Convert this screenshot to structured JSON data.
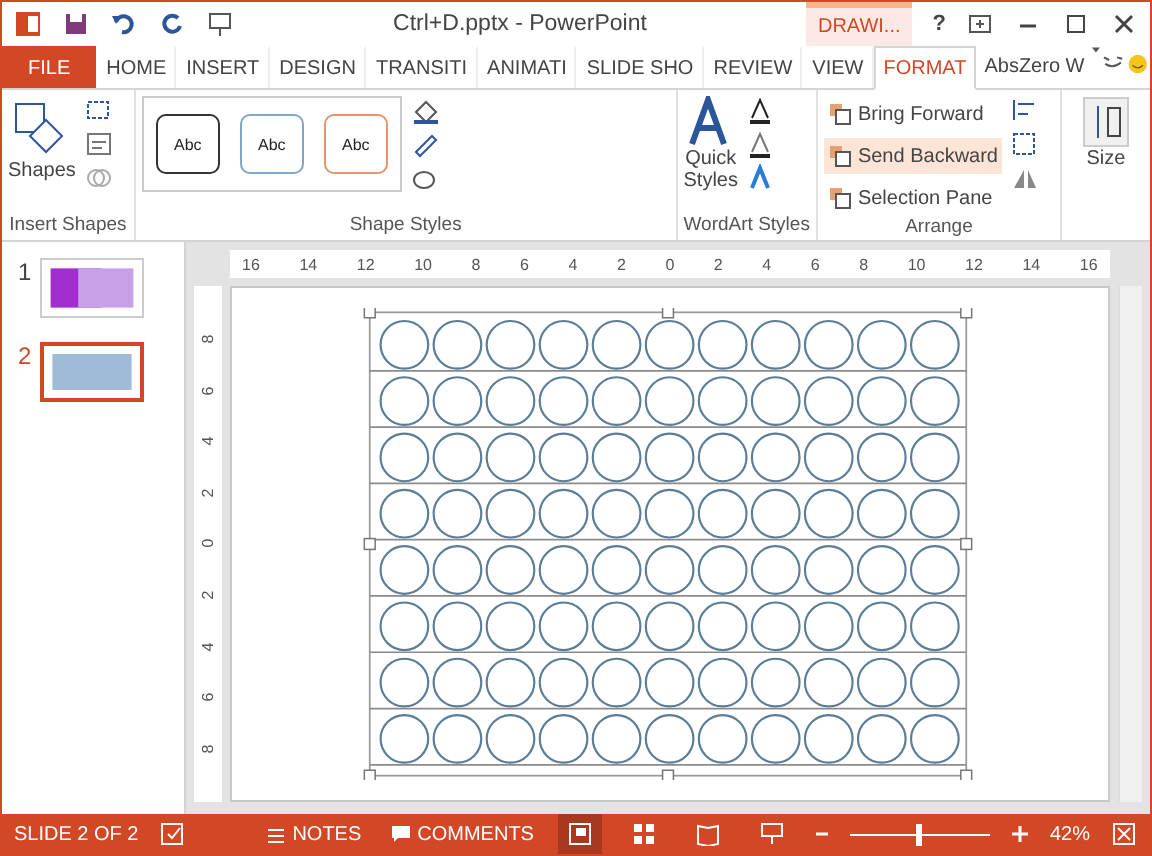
{
  "title_bar": {
    "title": "Ctrl+D.pptx - PowerPoint",
    "context_tab": "DRAWI...",
    "help": "?"
  },
  "tabs": [
    {
      "label": "FILE",
      "kind": "file",
      "selected": false
    },
    {
      "label": "HOME",
      "kind": "tab",
      "selected": false
    },
    {
      "label": "INSERT",
      "kind": "tab",
      "selected": false
    },
    {
      "label": "DESIGN",
      "kind": "tab",
      "selected": false
    },
    {
      "label": "TRANSITI",
      "kind": "tab",
      "selected": false
    },
    {
      "label": "ANIMATI",
      "kind": "tab",
      "selected": false
    },
    {
      "label": "SLIDE SHO",
      "kind": "tab",
      "selected": false
    },
    {
      "label": "REVIEW",
      "kind": "tab",
      "selected": false
    },
    {
      "label": "VIEW",
      "kind": "tab",
      "selected": false
    },
    {
      "label": "FORMAT",
      "kind": "tab",
      "selected": true
    }
  ],
  "account": {
    "user": "AbsZero W"
  },
  "ribbon": {
    "insert_shapes": {
      "button": "Shapes",
      "label": "Insert Shapes"
    },
    "shape_styles": {
      "label": "Shape Styles",
      "styles": [
        {
          "text": "Abc",
          "color": "#333333"
        },
        {
          "text": "Abc",
          "color": "#7fa7c9"
        },
        {
          "text": "Abc",
          "color": "#e8936a"
        }
      ]
    },
    "wordart": {
      "button_line1": "Quick",
      "button_line2": "Styles",
      "label": "WordArt Styles"
    },
    "arrange": {
      "label": "Arrange",
      "commands": [
        {
          "label": "Bring Forward",
          "selected": false
        },
        {
          "label": "Send Backward",
          "selected": true
        },
        {
          "label": "Selection Pane",
          "selected": false
        }
      ]
    },
    "size": {
      "button": "Size"
    }
  },
  "slides": [
    {
      "number": "1",
      "selected": false
    },
    {
      "number": "2",
      "selected": true
    }
  ],
  "ruler": {
    "horizontal": [
      "16",
      "14",
      "12",
      "10",
      "8",
      "6",
      "4",
      "2",
      "0",
      "2",
      "4",
      "6",
      "8",
      "10",
      "12",
      "14",
      "16"
    ],
    "vertical": [
      "8",
      "6",
      "4",
      "2",
      "0",
      "2",
      "4",
      "6",
      "8"
    ]
  },
  "status_bar": {
    "slide": "SLIDE 2 OF 2",
    "notes": "NOTES",
    "comments": "COMMENTS",
    "zoom": {
      "level": 0.5
    },
    "zoom_text": "42%"
  }
}
